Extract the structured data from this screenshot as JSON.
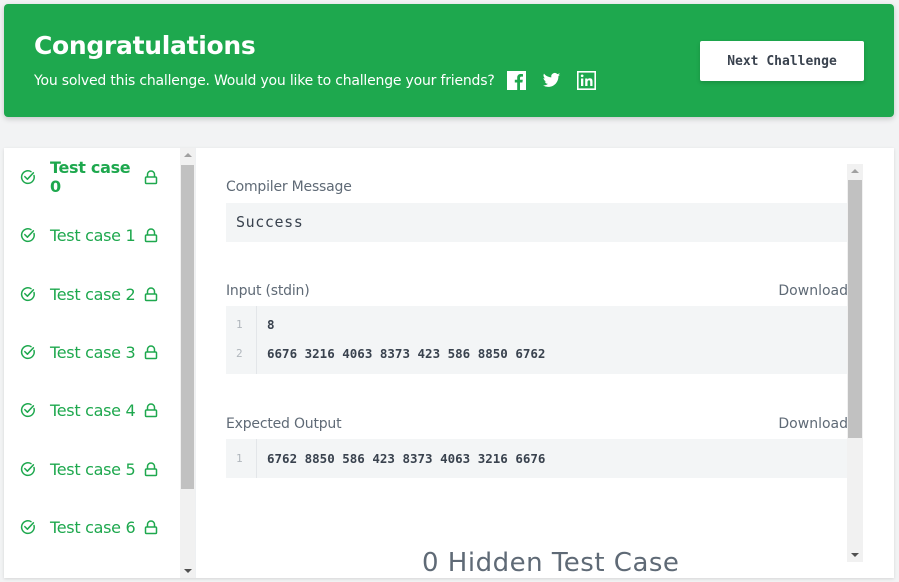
{
  "banner": {
    "title": "Congratulations",
    "subtitle": "You solved this challenge. Would you like to challenge your friends?",
    "social": [
      "facebook-icon",
      "twitter-icon",
      "linkedin-icon"
    ],
    "next_button": "Next Challenge",
    "color": "#1ea84e"
  },
  "test_cases": [
    {
      "label": "Test case 0",
      "active": true,
      "passed": true,
      "locked": true
    },
    {
      "label": "Test case 1",
      "active": false,
      "passed": true,
      "locked": true
    },
    {
      "label": "Test case 2",
      "active": false,
      "passed": true,
      "locked": true
    },
    {
      "label": "Test case 3",
      "active": false,
      "passed": true,
      "locked": true
    },
    {
      "label": "Test case 4",
      "active": false,
      "passed": true,
      "locked": true
    },
    {
      "label": "Test case 5",
      "active": false,
      "passed": true,
      "locked": true
    },
    {
      "label": "Test case 6",
      "active": false,
      "passed": true,
      "locked": true
    }
  ],
  "detail": {
    "compiler_label": "Compiler Message",
    "compiler_message": "Success",
    "input_label": "Input (stdin)",
    "input_download": "Download",
    "input_lines": [
      {
        "n": "1",
        "text": "8"
      },
      {
        "n": "2",
        "text": "6676 3216 4063 8373 423 586 8850 6762"
      }
    ],
    "expected_label": "Expected Output",
    "expected_download": "Download",
    "expected_lines": [
      {
        "n": "1",
        "text": "6762 8850 586 423 8373 4063 3216 6676"
      }
    ],
    "hidden_title": "0 Hidden Test Case"
  }
}
